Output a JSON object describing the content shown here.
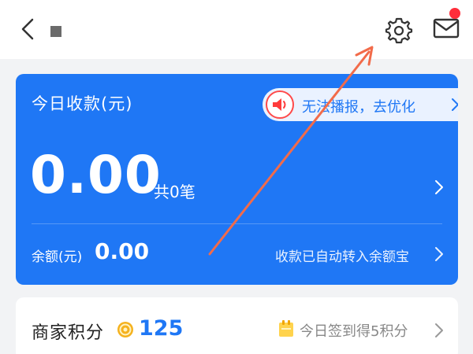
{
  "header": {
    "back_icon": "chevron-left-icon",
    "settings_icon": "gear-icon",
    "mail_icon": "envelope-icon",
    "mail_badge_color": "#ff2d3a"
  },
  "today_card": {
    "title": "今日收款(元)",
    "broadcast_text": "无法播报，去优化",
    "amount": "0.00",
    "count_text": "共0笔",
    "balance_label": "余额(元)",
    "balance_value": "0.00",
    "transfer_text": "收款已自动转入余额宝",
    "accent_color": "#1f77f5"
  },
  "points_card": {
    "label": "商家积分",
    "value": "125",
    "checkin_text": "今日签到得5积分"
  },
  "annotation": {
    "color": "#f26b4a"
  }
}
